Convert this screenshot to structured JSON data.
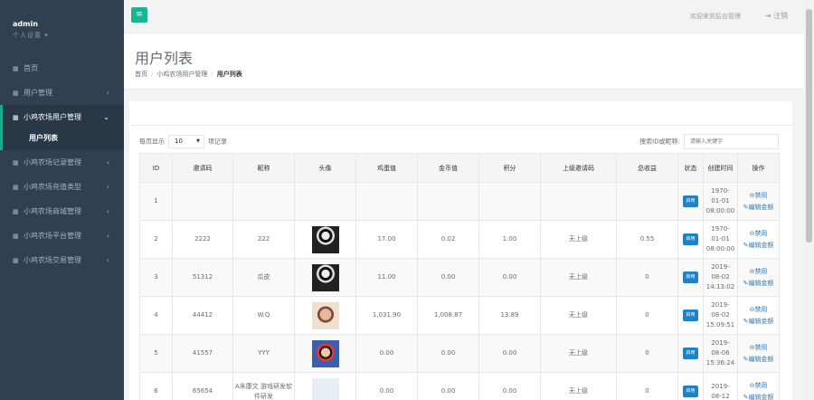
{
  "sidebar": {
    "user": "admin",
    "profile_menu": "个人设置",
    "items": [
      {
        "label": "首页"
      },
      {
        "label": "用户管理"
      },
      {
        "label": "小鸡农场用户管理"
      },
      {
        "label": "小鸡农场记录管理"
      },
      {
        "label": "小鸡农场充值类型"
      },
      {
        "label": "小鸡农场商城管理"
      },
      {
        "label": "小鸡农场平台管理"
      },
      {
        "label": "小鸡农场交易管理"
      }
    ],
    "active_sub": "用户列表"
  },
  "topbar": {
    "welcome": "欢迎来到后台管理",
    "logout": "注销"
  },
  "page": {
    "title": "用户列表",
    "breadcrumb": [
      "首页",
      "小鸡农场用户管理",
      "用户列表"
    ]
  },
  "table_controls": {
    "show_prefix": "每页显示",
    "page_size": "10",
    "show_suffix": "项记录",
    "search_label": "搜索ID或昵称:",
    "search_placeholder": "请输入关键字"
  },
  "table": {
    "headers": [
      "ID",
      "邀请码",
      "昵称",
      "头像",
      "鸡蛋值",
      "金币值",
      "积分",
      "上级邀请码",
      "总收益",
      "状态",
      "创建时间",
      "操作"
    ],
    "status_label": "启用",
    "action_disable": "禁用",
    "action_edit": "编辑金额",
    "rows": [
      {
        "id": "1",
        "code": "",
        "nick": "",
        "avatar": "",
        "egg": "",
        "coin": "",
        "points": "",
        "parent": "",
        "income": "",
        "date": "1970-",
        "date2": "01-01",
        "time": "08:00:00"
      },
      {
        "id": "2",
        "code": "2222",
        "nick": "222",
        "avatar": "av-dark",
        "egg": "17.00",
        "coin": "0.02",
        "points": "1.00",
        "parent": "无上级",
        "income": "0.55",
        "date": "1970-",
        "date2": "01-01",
        "time": "08:00:00"
      },
      {
        "id": "3",
        "code": "51312",
        "nick": "瓜皮",
        "avatar": "av-dark",
        "egg": "11.00",
        "coin": "0.00",
        "points": "0.00",
        "parent": "无上级",
        "income": "0",
        "date": "2019-",
        "date2": "08-02",
        "time": "14:13:02"
      },
      {
        "id": "4",
        "code": "44412",
        "nick": "W.Q",
        "avatar": "av-kid",
        "egg": "1,031.90",
        "coin": "1,008.87",
        "points": "13.89",
        "parent": "无上级",
        "income": "0",
        "date": "2019-",
        "date2": "08-02",
        "time": "15:09:51"
      },
      {
        "id": "5",
        "code": "41557",
        "nick": "YYY",
        "avatar": "av-girl",
        "egg": "0.00",
        "coin": "0.00",
        "points": "0.00",
        "parent": "无上级",
        "income": "0",
        "date": "2019-",
        "date2": "08-06",
        "time": "15:36:24"
      },
      {
        "id": "6",
        "code": "65654",
        "nick": "A朱康文 游戏研发软件研发",
        "avatar": "av-light",
        "egg": "0.00",
        "coin": "0.00",
        "points": "0.00",
        "parent": "无上级",
        "income": "0",
        "date": "2019-",
        "date2": "08-12",
        "time": ""
      }
    ]
  }
}
